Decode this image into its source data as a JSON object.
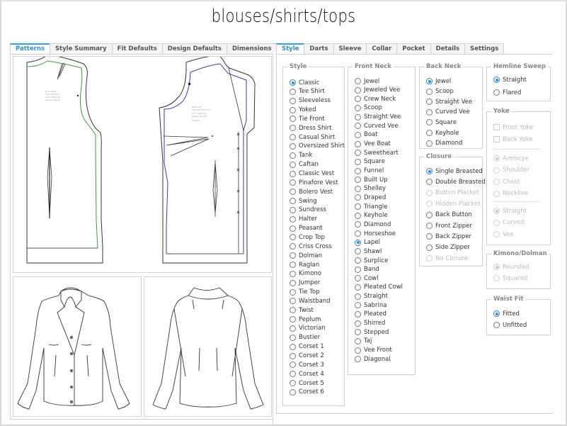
{
  "title": "blouses/shirts/tops",
  "left_tabs": [
    {
      "label": "Patterns",
      "active": true
    },
    {
      "label": "Style Summary",
      "active": false
    },
    {
      "label": "Fit Defaults",
      "active": false
    },
    {
      "label": "Design Defaults",
      "active": false
    },
    {
      "label": "Dimensions",
      "active": false
    }
  ],
  "right_tabs": [
    {
      "label": "Style",
      "active": true
    },
    {
      "label": "Darts",
      "active": false
    },
    {
      "label": "Sleeve",
      "active": false
    },
    {
      "label": "Collar",
      "active": false
    },
    {
      "label": "Pocket",
      "active": false
    },
    {
      "label": "Details",
      "active": false
    },
    {
      "label": "Settings",
      "active": false
    }
  ],
  "colors": {
    "accent": "#2a8fd6",
    "front_seam": "#3c9a3c",
    "back_seam": "#3a3aa8"
  },
  "groups": {
    "style": {
      "title": "Style",
      "selected": "Classic",
      "options": [
        "Classic",
        "Tee Shirt",
        "Sleeveless",
        "Yoked",
        "Tie Front",
        "Dress Shirt",
        "Casual Shirt",
        "Oversized Shirt",
        "Tank",
        "Caftan",
        "Classic Vest",
        "Pinafore Vest",
        "Bolero Vest",
        "Swing",
        "Sundress",
        "Halter",
        "Peasant",
        "Crop Top",
        "Criss Cross",
        "Dolman",
        "Raglan",
        "Kimono",
        "Jumper",
        "Tie Top",
        "Waistband",
        "Twist",
        "Peplum",
        "Victorian",
        "Bustier",
        "Corset 1",
        "Corset 2",
        "Corset 3",
        "Corset 4",
        "Corset 5",
        "Corset 6"
      ]
    },
    "front_neck": {
      "title": "Front Neck",
      "selected": "Lapel",
      "options": [
        "Jewel",
        "Jeweled Vee",
        "Crew Neck",
        "Scoop",
        "Straight Vee",
        "Curved Vee",
        "Boat",
        "Vee Boat",
        "Sweetheart",
        "Square",
        "Funnel",
        "Built Up",
        "Shelley",
        "Draped",
        "Triangle",
        "Keyhole",
        "Diamond",
        "Horseshoe",
        "Lapel",
        "Shawl",
        "Surplice",
        "Band",
        "Cowl",
        "Pleated Cowl",
        "Straight",
        "Sabrina",
        "Pleated",
        "Shirred",
        "Stepped",
        "Taj",
        "Vee Front",
        "Diagonal"
      ]
    },
    "back_neck": {
      "title": "Back Neck",
      "selected": "Jewel",
      "options": [
        "Jewel",
        "Scoop",
        "Straight Vee",
        "Curved Vee",
        "Square",
        "Keyhole",
        "Diamond"
      ]
    },
    "closure": {
      "title": "Closure",
      "selected": "Single Breasted",
      "options": [
        "Single Breasted",
        "Double Breasted",
        "Button Placket",
        "Hidden Placket",
        "Back Button",
        "Front Zipper",
        "Back Zipper",
        "Side Zipper",
        "No Closure"
      ],
      "disabled": [
        "Button Placket",
        "Hidden Placket",
        "No Closure"
      ]
    },
    "hemline_sweep": {
      "title": "Hemline Sweep",
      "selected": "Straight",
      "options": [
        "Straight",
        "Flared"
      ]
    },
    "yoke": {
      "title": "Yoke",
      "checkboxes": [
        {
          "label": "Front Yoke",
          "checked": false
        },
        {
          "label": "Back Yoke",
          "checked": false
        }
      ],
      "position_selected": "Armscye",
      "positions": [
        "Armscye",
        "Shoulder",
        "Chest",
        "Neckline"
      ],
      "shape_selected": "Straight",
      "shapes": [
        "Straight",
        "Curved",
        "Vee"
      ],
      "disabled": true
    },
    "kimono_dolman": {
      "title": "Kimono/Dolman",
      "selected": "Rounded",
      "options": [
        "Rounded",
        "Squared"
      ],
      "disabled": true
    },
    "waist_fit": {
      "title": "Waist Fit",
      "selected": "Fitted",
      "options": [
        "Fitted",
        "Unfitted"
      ]
    }
  },
  "pattern_labels": {
    "front": [
      "Front / Right",
      "Cut 1 Self Fabric",
      "Cut 1 Interfacing",
      "Size 10 / Regular"
    ],
    "back": [
      "Back / Left",
      "Cut 1 Self Fabric Fold",
      "Cut 1 Interfacing",
      "Size 10 / Regular",
      "Grainline"
    ]
  }
}
